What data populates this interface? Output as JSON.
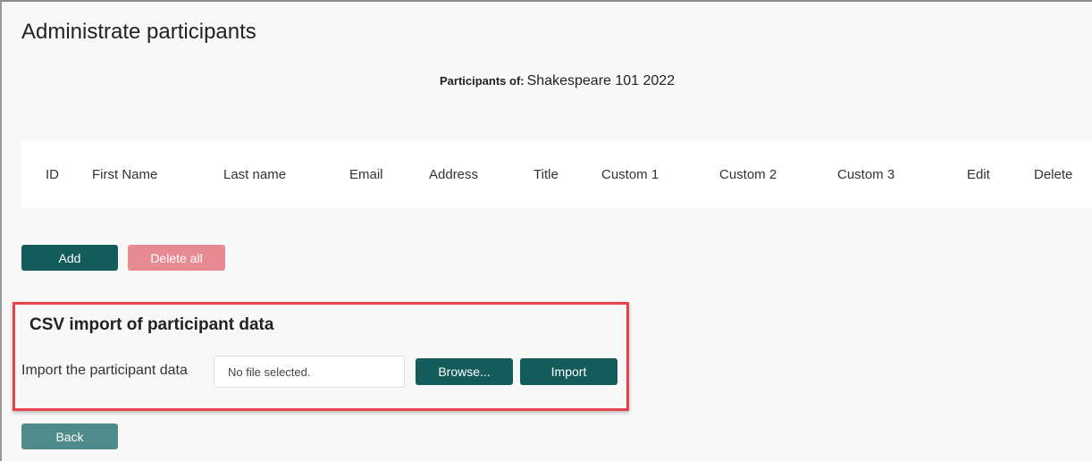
{
  "page": {
    "title": "Administrate participants",
    "participants_label": "Participants of:",
    "course_name": "Shakespeare 101 2022"
  },
  "table": {
    "columns": [
      "ID",
      "First Name",
      "Last name",
      "Email",
      "Address",
      "Title",
      "Custom 1",
      "Custom 2",
      "Custom 3",
      "Edit",
      "Delete"
    ]
  },
  "actions": {
    "add_label": "Add",
    "delete_all_label": "Delete all"
  },
  "csv_import": {
    "title": "CSV import of participant data",
    "field_label": "Import the participant data",
    "file_status": "No file selected.",
    "browse_label": "Browse...",
    "import_label": "Import"
  },
  "footer": {
    "back_label": "Back"
  },
  "colors": {
    "primary": "#145c5c",
    "danger_disabled": "#e88a92",
    "back": "#4f8b8b",
    "highlight_border": "#e5424c"
  }
}
